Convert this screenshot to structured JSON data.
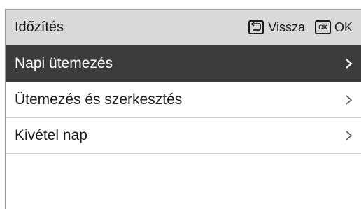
{
  "header": {
    "title": "Időzítés",
    "back_label": "Vissza",
    "back_icon": "back-return-icon",
    "ok_key_text": "OK",
    "ok_label": "OK"
  },
  "menu": {
    "items": [
      {
        "label": "Napi ütemezés",
        "selected": true,
        "icon": "chevron-right-icon"
      },
      {
        "label": "Ütemezés és szerkesztés",
        "selected": false,
        "icon": "chevron-right-icon"
      },
      {
        "label": "Kivétel nap",
        "selected": false,
        "icon": "chevron-right-icon"
      }
    ]
  },
  "colors": {
    "header_bg": "#d9d9d9",
    "selected_bg": "#3c3c3c",
    "text": "#1a1a1a",
    "selected_text": "#ffffff",
    "divider": "#cfcfcf"
  }
}
